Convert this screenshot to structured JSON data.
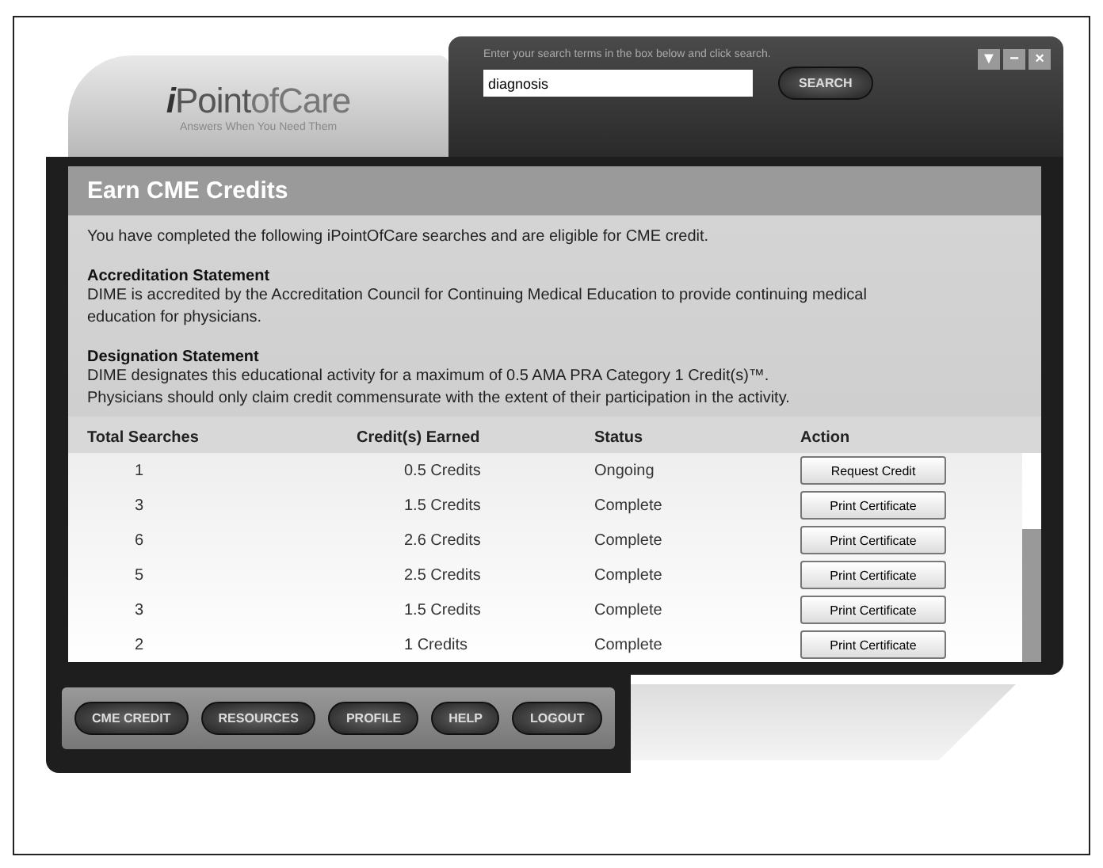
{
  "logo": {
    "name_prefix": "i",
    "name_main": "Point",
    "name_suffix": "ofCare",
    "tagline": "Answers When You Need Them"
  },
  "search": {
    "hint": "Enter your search terms in the box below and click search.",
    "value": "diagnosis",
    "button": "SEARCH"
  },
  "window_controls": [
    "▼",
    "−",
    "×"
  ],
  "panel": {
    "title": "Earn CME Credits",
    "intro": "You have completed the following iPointOfCare searches and are eligible for CME credit.",
    "sections": [
      {
        "heading": "Accreditation Statement",
        "lines": [
          "DIME is accredited by the Accreditation Council for Continuing Medical Education to provide continuing medical education for physicians."
        ]
      },
      {
        "heading": "Designation Statement",
        "lines": [
          "DIME designates this educational activity for a maximum of 0.5 AMA PRA Category 1 Credit(s)™.",
          "Physicians should only claim credit commensurate with the extent of their participation in the activity."
        ]
      }
    ]
  },
  "table": {
    "columns": [
      "Total Searches",
      "Credit(s) Earned",
      "Status",
      "Action"
    ],
    "rows": [
      {
        "searches": "1",
        "credits": "0.5 Credits",
        "status": "Ongoing",
        "action": "Request Credit"
      },
      {
        "searches": "3",
        "credits": "1.5 Credits",
        "status": "Complete",
        "action": "Print Certificate"
      },
      {
        "searches": "6",
        "credits": "2.6 Credits",
        "status": "Complete",
        "action": "Print Certificate"
      },
      {
        "searches": "5",
        "credits": "2.5 Credits",
        "status": "Complete",
        "action": "Print Certificate"
      },
      {
        "searches": "3",
        "credits": "1.5 Credits",
        "status": "Complete",
        "action": "Print Certificate"
      },
      {
        "searches": "2",
        "credits": "1 Credits",
        "status": "Complete",
        "action": "Print Certificate"
      }
    ]
  },
  "nav": [
    "CME CREDIT",
    "RESOURCES",
    "PROFILE",
    "HELP",
    "LOGOUT"
  ]
}
